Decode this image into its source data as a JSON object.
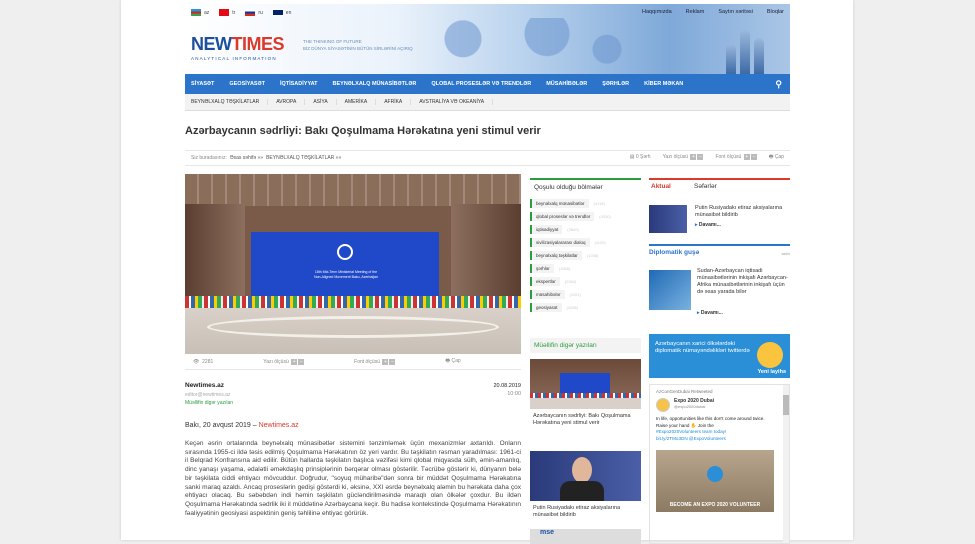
{
  "header": {
    "langs": [
      {
        "code": "az",
        "flag": "#1e9bd7"
      },
      {
        "code": "tr",
        "flag": "#e30a17"
      },
      {
        "code": "ru",
        "flag": "#ffffff"
      },
      {
        "code": "en",
        "flag": "#012169"
      }
    ],
    "top_links": [
      "Haqqımızda",
      "Reklam",
      "Saytın xəritəsi",
      "Bloqlar"
    ],
    "logo_new": "NEW",
    "logo_times": "TIMES",
    "logo_sub": "ANALYTICAL INFORMATION",
    "tagline1": "THE THINKING OF FUTURE",
    "tagline2": "BİZ DÜNYA SİYASƏTİNİN BÜTÜN SİRLƏRİNİ AÇIRIQ"
  },
  "nav": [
    "SİYASƏT",
    "GEOSİYASƏT",
    "İQTİSADİYYAT",
    "BEYNƏLXALQ MÜNASİBƏTLƏR",
    "QLOBAL PROSESLƏR VƏ TRENDLƏR",
    "MÜSAHİBƏLƏR",
    "ŞƏRHLƏR",
    "KİBER MƏKAN"
  ],
  "subnav": [
    "BEYNƏLXALQ TƏŞKİLATLAR",
    "AVROPA",
    "ASİYA",
    "AMERİKA",
    "AFRİKA",
    "AVSTRALİYA VƏ OKEANİYA"
  ],
  "article": {
    "title": "Azərbaycanın sədrliyi: Bakı Qoşulmama Hərəkatına yeni stimul verir",
    "breadcrumb_prefix": "Siz buradasınız:",
    "breadcrumb_home": "Əsas səhifə »»",
    "breadcrumb_cat": "BEYNƏLXALQ TƏŞKİLATLAR »»",
    "tool_print_top": "Şərh",
    "tool_font": "Yazı ölçüsü",
    "tool_font2": "Font ölçüsü",
    "tool_print": "Çap",
    "views": "2281",
    "count_top": "0",
    "screen_text": "18th Mid-Term Ministerial Meeting of the Non-Aligned Movement Baku, Azerbaijan",
    "author": "Newtimes.az",
    "email": "editor@newtimes.az",
    "other_posts": "Müəllifin digər yazıları",
    "date": "20.08.2019",
    "time": "10:00",
    "dateline_place": "Bakı, 20 avqust 2019 –",
    "dateline_src": "Newtimes.az",
    "body": "Keçən əsrin ortalarında beynəlxalq münasibətlər sistemini tənzimləmək üçün mexanizmlər axtarıldı. Onların sırasında 1955-ci ildə təsis edilmiş Qoşulmama Hərəkatının öz yeri vardır. Bu təşkilatın rəsman yaradılması: 1961-ci il Belqrad Konfransına aid edilir. Bütün hallarda təşkilatın başlıca vəzifəsi kimi qlobal miqyasda sülh, əmin-amanlıq, dinc yanaşı yaşama, ədalətli əməkdaşlıq prinsiplərinin bərqərar olması göstərilir. Təcrübə göstərir ki, dünyanın belə bir təşkilata ciddi ehtiyacı mövcuddur. Doğrudur, \"soyuq müharibə\"dən sonra bir müddət Qoşulmama Hərəkatına sanki maraq azaldı. Ancaq proseslərin gedişi göstərdi ki, əksinə, XXI əsrdə beynəlxalq aləmin bu hərəkata daha çox ehtiyacı olacaq. Bu səbəbdən indi həmin təşkilatın gücləndirilməsində maraqlı olan ölkələr çoxdur. Bu ildən Qoşulmama Hərəkatında sədrlik iki il müddətinə Azərbaycana keçir. Bu hadisə kontekstində Qoşulmama Hərəkatının fəaliyyətinin geosiyasi aspektinin geniş təhlilinə ehtiyac görürük."
  },
  "cats_box": {
    "title": "Qoşulu olduğu bölmələr",
    "items": [
      {
        "label": "beynəlxalq münasibətlər",
        "n": "(4118)"
      },
      {
        "label": "qlobal proseslər və trendlər",
        "n": "(4330)"
      },
      {
        "label": "iqtisadiyyat",
        "n": "(3849)"
      },
      {
        "label": "sivilizasiyalararası dialoq",
        "n": "(1120)"
      },
      {
        "label": "beynəlxalq təşkilatlar",
        "n": "(1038)"
      },
      {
        "label": "şərhlər",
        "n": "(1556)"
      },
      {
        "label": "ekspertlər",
        "n": "(2284)"
      },
      {
        "label": "müsahibələr",
        "n": "(1021)"
      },
      {
        "label": "geosiyasət",
        "n": "(4296)"
      }
    ]
  },
  "other": {
    "title": "Müəllifin digər yazıları",
    "items": [
      {
        "text": "Azərbaycanın sədrliyi: Bakı Qoşulmama Hərəkatına yeni stimul verir"
      },
      {
        "text": "Putin Rusiyadakı etiraz aksiyalarına münasibət bildirib"
      }
    ],
    "third_label": "mse"
  },
  "right": {
    "tab_active": "Aktual",
    "tab_other": "Səfərlər",
    "news1": "Putin Rusiyadakı etiraz aksiyalarına münasibət bildirib",
    "more": "Davamı...",
    "dipl_title": "Diplomatik guşə",
    "dipl_all": "arxiv",
    "news2": "Sudan-Azərbaycan iqtisadi münasibətlərinin inkişafı Azərbaycan-Afrika münasibətlərinin inkişafı üçün də əsas yarada bilər",
    "banner_text": "Azərbaycanın xarici ölkələrdəki diplomatik nümayəndəlikləri twitterdə",
    "banner_link": "Yeni layihə",
    "twitter": {
      "retweet": "AzConGenDubai Retweeted",
      "name": "Expo 2020 Dubai",
      "handle": "@expo2020dubai",
      "body1": "In life, opportunities like this don't come around twice.",
      "body2": "Raise your hand ✋ Join the",
      "tag": "#Expo2020Volunteers team today!",
      "link": "bit.ly/2TMo3DN @ExpoVolunteers",
      "video_caption": "BECOME AN EXPO 2020 VOLUNTEER"
    }
  }
}
